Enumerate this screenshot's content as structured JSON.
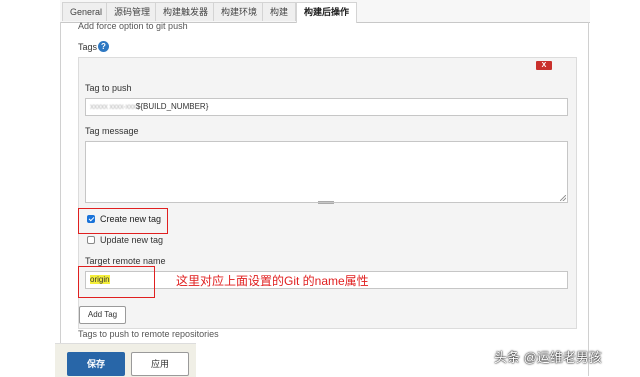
{
  "tabs": [
    {
      "label": "General"
    },
    {
      "label": "源码管理"
    },
    {
      "label": "构建触发器"
    },
    {
      "label": "构建环境"
    },
    {
      "label": "构建"
    },
    {
      "label": "构建后操作"
    }
  ],
  "force_option_text": "Add force option to git push",
  "tags_label": "Tags",
  "help_glyph": "?",
  "delete_glyph": "X",
  "tag_to_push": {
    "label": "Tag to push",
    "value_blurred": "xxxxx xxxx-xxx",
    "value": "${BUILD_NUMBER}"
  },
  "tag_message": {
    "label": "Tag message",
    "value": ""
  },
  "create_new_tag": {
    "label": "Create new tag",
    "checked": true
  },
  "update_new_tag": {
    "label": "Update new tag",
    "checked": false
  },
  "target_remote": {
    "label": "Target remote name",
    "value": "origin"
  },
  "annotation": "这里对应上面设置的Git 的name属性",
  "add_tag_button": "Add Tag",
  "remote_repos_text": "Tags to push to remote repositories",
  "save_button": "保存",
  "apply_button": "应用",
  "watermark": "头条 @运维老男孩",
  "colors": {
    "annotation": "#e02020",
    "save": "#2866a8",
    "delete": "#c9302c",
    "highlight": "#f5ef3a"
  }
}
